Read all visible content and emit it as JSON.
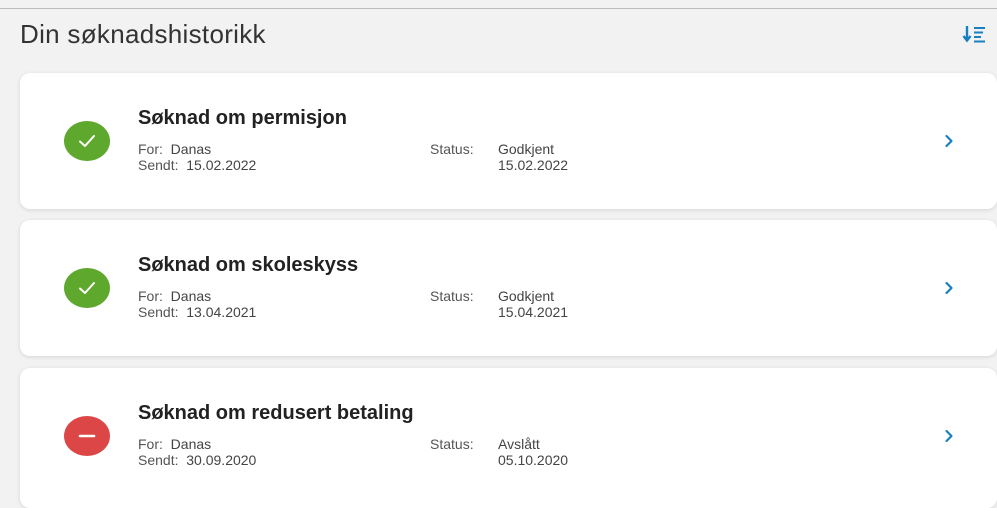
{
  "header": {
    "title": "Din søknadshistorikk",
    "sort_icon": "sort-descending-icon"
  },
  "colors": {
    "accent": "#1a7fc1",
    "approved": "#5fa82e",
    "rejected": "#dc4646"
  },
  "applications": [
    {
      "title": "Søknad om permisjon",
      "for_label": "For:",
      "for_value": "Danas",
      "sent_label": "Sendt:",
      "sent_value": "15.02.2022",
      "status_label": "Status:",
      "status_value": "Godkjent",
      "status_date": "15.02.2022",
      "status_icon": "checkmark-icon"
    },
    {
      "title": "Søknad om skoleskyss",
      "for_label": "For:",
      "for_value": "Danas",
      "sent_label": "Sendt:",
      "sent_value": "13.04.2021",
      "status_label": "Status:",
      "status_value": "Godkjent",
      "status_date": "15.04.2021",
      "status_icon": "checkmark-icon"
    },
    {
      "title": "Søknad om redusert betaling",
      "for_label": "For:",
      "for_value": "Danas",
      "sent_label": "Sendt:",
      "sent_value": "30.09.2020",
      "status_label": "Status:",
      "status_value": "Avslått",
      "status_date": "05.10.2020",
      "status_icon": "minus-icon"
    }
  ]
}
